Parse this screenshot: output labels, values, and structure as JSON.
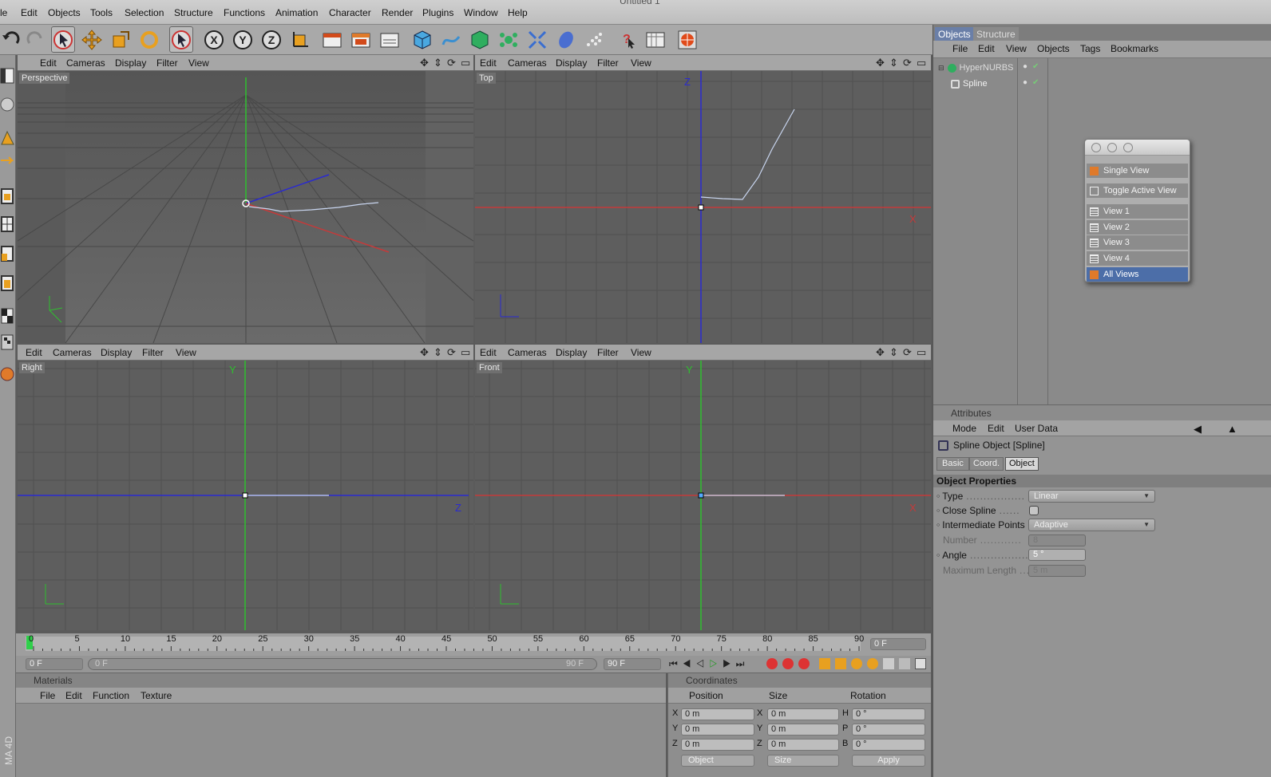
{
  "window_title": "Untitled 1",
  "menubar": [
    "le",
    "Edit",
    "Objects",
    "Tools",
    "Selection",
    "Structure",
    "Functions",
    "Animation",
    "Character",
    "Render",
    "Plugins",
    "Window",
    "Help"
  ],
  "toolbar": {
    "tools": [
      "undo-icon",
      "redo-icon",
      "live-selection-icon",
      "move-icon",
      "scale-icon",
      "rotate-icon",
      "selection-mode-icon",
      "x-axis-icon",
      "y-axis-icon",
      "z-axis-icon",
      "world-coordinates-icon",
      "render-view-icon",
      "render-picture-viewer-icon",
      "render-settings-icon",
      "cube-icon",
      "spline-pen-icon",
      "nurbs-icon",
      "array-icon",
      "deformer-icon",
      "environment-icon",
      "particle-icon",
      "help-pointer-icon",
      "timeline-icon",
      "browser-icon"
    ],
    "axis_labels": [
      "X",
      "Y",
      "Z"
    ]
  },
  "viewport_menu": [
    "Edit",
    "Cameras",
    "Display",
    "Filter",
    "View"
  ],
  "viewports": [
    {
      "label": "Perspective"
    },
    {
      "label": "Top",
      "axis_a": "Z",
      "axis_b": "X"
    },
    {
      "label": "Right",
      "axis_a": "Y",
      "axis_b": "Z"
    },
    {
      "label": "Front",
      "axis_a": "Y",
      "axis_b": "X"
    }
  ],
  "objects_panel": {
    "tabs": [
      "Objects",
      "Structure"
    ],
    "menu": [
      "File",
      "Edit",
      "View",
      "Objects",
      "Tags",
      "Bookmarks"
    ],
    "items": [
      {
        "name": "HyperNURBS",
        "icon": "hypernurbs-icon"
      },
      {
        "name": "Spline",
        "icon": "spline-icon"
      }
    ]
  },
  "view_popup": {
    "items": [
      "Single View",
      "Toggle Active View",
      "View 1",
      "View 2",
      "View 3",
      "View 4",
      "All Views"
    ],
    "accent": "#e07a2a"
  },
  "attributes": {
    "header": "Attributes",
    "menu": [
      "Mode",
      "Edit",
      "User Data"
    ],
    "object_title": "Spline Object [Spline]",
    "tabs": [
      "Basic",
      "Coord.",
      "Object"
    ],
    "section": "Object Properties",
    "props": {
      "type_label": "Type",
      "type_value": "Linear",
      "close_label": "Close Spline",
      "interp_label": "Intermediate Points",
      "interp_value": "Adaptive",
      "number_label": "Number",
      "number_value": "8",
      "angle_label": "Angle",
      "angle_value": "5 °",
      "maxlen_label": "Maximum Length",
      "maxlen_value": "5 m"
    }
  },
  "timeline": {
    "ticks": [
      "0",
      "5",
      "10",
      "15",
      "20",
      "25",
      "30",
      "35",
      "40",
      "45",
      "50",
      "55",
      "60",
      "65",
      "70",
      "75",
      "80",
      "85",
      "90"
    ],
    "current_frame": "0 F",
    "start_field": "0 F",
    "slider_start": "0 F",
    "slider_end": "90 F",
    "end_field": "90 F"
  },
  "materials": {
    "header": "Materials",
    "menu": [
      "File",
      "Edit",
      "Function",
      "Texture"
    ]
  },
  "coordinates": {
    "header": "Coordinates",
    "columns": [
      "Position",
      "Size",
      "Rotation"
    ],
    "rows": [
      {
        "a": "X",
        "pos": "0 m",
        "b": "X",
        "size": "0 m",
        "c": "H",
        "rot": "0 °"
      },
      {
        "a": "Y",
        "pos": "0 m",
        "b": "Y",
        "size": "0 m",
        "c": "P",
        "rot": "0 °"
      },
      {
        "a": "Z",
        "pos": "0 m",
        "b": "Z",
        "size": "0 m",
        "c": "B",
        "rot": "0 °"
      }
    ],
    "mode_object": "Object",
    "mode_size": "Size",
    "apply": "Apply"
  },
  "side_label": "MA 4D",
  "colors": {
    "x_axis": "#c43a3a",
    "y_axis": "#2fbf2f",
    "z_axis": "#2a2ad0",
    "spline": "#c9d6f0",
    "orange": "#e07a2a"
  }
}
